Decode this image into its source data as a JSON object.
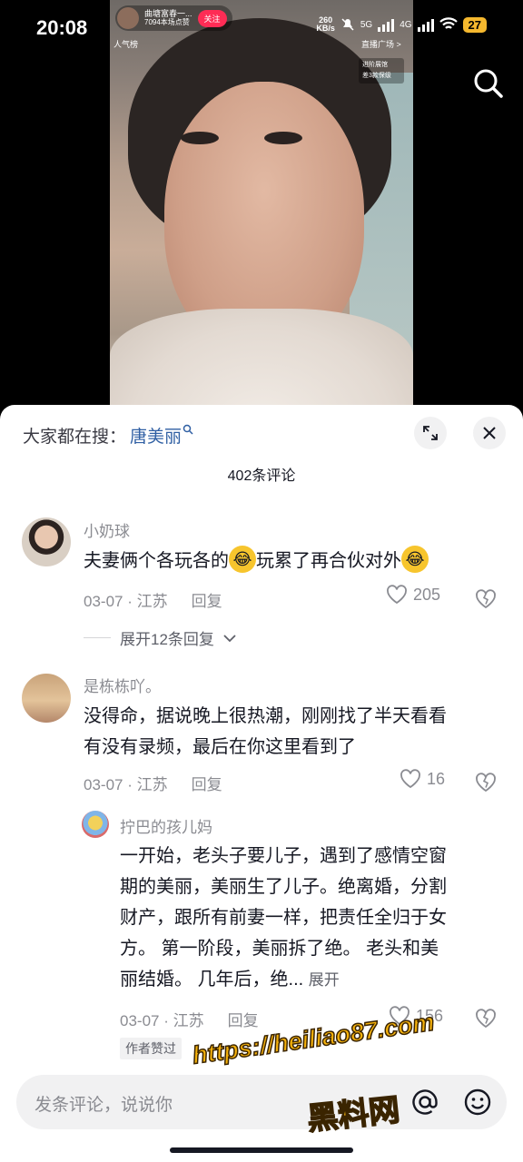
{
  "status_bar": {
    "time": "20:08",
    "net_speed_value": "260",
    "net_speed_unit": "KB/s",
    "network_1": "5G",
    "network_2": "4G",
    "battery": "27"
  },
  "live": {
    "host_name": "曲塘富春一...",
    "host_sub": "7094本场点赞",
    "follow_label": "关注",
    "rank_label": "人气榜",
    "plaza_label": "直播广场 >",
    "progress_line1": "进阶展馆",
    "progress_line2": "差3款保级"
  },
  "sheet": {
    "hot_search_prefix": "大家都在搜：",
    "hot_search_term": "唐美丽",
    "comment_count": "402条评论"
  },
  "comments": [
    {
      "username": "小奶球",
      "text_part1": "夫妻俩个各玩各的",
      "text_part2": "玩累了再合伙对外",
      "date": "03-07",
      "location": "江苏",
      "reply_label": "回复",
      "likes": "205",
      "expand_label": "展开12条回复"
    },
    {
      "username": "是栋栋吖。",
      "text_line1": "没得命，据说晚上很热潮，刚刚找了半天看看",
      "text_line2": "有没有录频，最后在你这里看到了",
      "date": "03-07",
      "location": "江苏",
      "reply_label": "回复",
      "likes": "16"
    }
  ],
  "reply": {
    "username": "拧巴的孩儿妈",
    "line1": "一开始，老头子要儿子，遇到了感情空窗",
    "line2": "期的美丽，美丽生了儿子。绝离婚，分割",
    "line3": "财产，跟所有前妻一样，把责任全归于女",
    "line4": "方。 第一阶段，美丽拆了绝。 老头和美",
    "line5": "丽结婚。 几年后，绝...",
    "more_label": "展开",
    "date": "03-07",
    "location": "江苏",
    "reply_label": "回复",
    "likes": "156",
    "author_liked_label": "作者赞过"
  },
  "input": {
    "placeholder": "发条评论，说说你"
  },
  "watermark": {
    "url": "https://heiliao87.com",
    "name": "黑料网"
  },
  "colors": {
    "accent_red": "#fe2c55",
    "link_blue": "#2f5fa3",
    "watermark_gold": "#f4b10c"
  }
}
